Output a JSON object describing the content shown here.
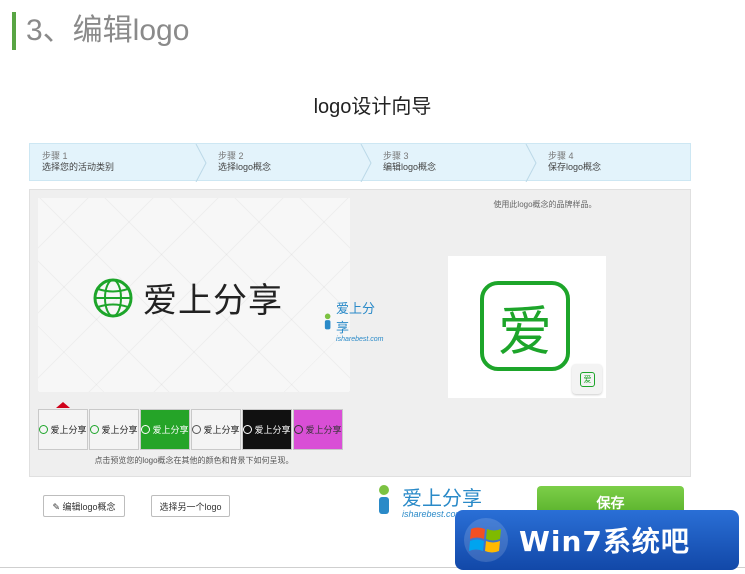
{
  "section_heading": "3、编辑logo",
  "wizard_title": "logo设计向导",
  "steps": [
    {
      "num": "步骤 1",
      "label": "选择您的活动类别"
    },
    {
      "num": "步骤 2",
      "label": "选择logo概念"
    },
    {
      "num": "步骤 3",
      "label": "编辑logo概念"
    },
    {
      "num": "步骤 4",
      "label": "保存logo概念"
    }
  ],
  "preview": {
    "logo_text": "爱上分享",
    "watermark_cn": "爱上分享",
    "watermark_en": "isharebest.com"
  },
  "sample": {
    "hint": "使用此logo概念的品牌样品。",
    "icon_char": "爱",
    "mini_char": "爱"
  },
  "thumbnails": [
    {
      "label": "爱上分享",
      "bg": "#f4f4f4",
      "fg": "#222222",
      "icon": "#1da52a"
    },
    {
      "label": "爱上分享",
      "bg": "#f4f4f4",
      "fg": "#222222",
      "icon": "#1da52a"
    },
    {
      "label": "爱上分享",
      "bg": "#25a428",
      "fg": "#ffffff",
      "icon": "#ffffff"
    },
    {
      "label": "爱上分享",
      "bg": "#f4f4f4",
      "fg": "#222222",
      "icon": "#555555"
    },
    {
      "label": "爱上分享",
      "bg": "#111111",
      "fg": "#ffffff",
      "icon": "#ffffff"
    },
    {
      "label": "爱上分享",
      "bg": "#d94fd6",
      "fg": "#333333",
      "icon": "#333333"
    }
  ],
  "thumb_hint": "点击预览您的logo概念在其他的颜色和背景下如何呈现。",
  "buttons": {
    "edit": "编辑logo概念",
    "other": "选择另一个logo",
    "save": "保存"
  },
  "footer_brand": {
    "cn": "爱上分享",
    "en": "isharebest.com"
  },
  "badge_text": "Win7系统吧",
  "colors": {
    "accent_green": "#58a543",
    "logo_green": "#1da52a",
    "brand_blue": "#2a8ac8"
  }
}
